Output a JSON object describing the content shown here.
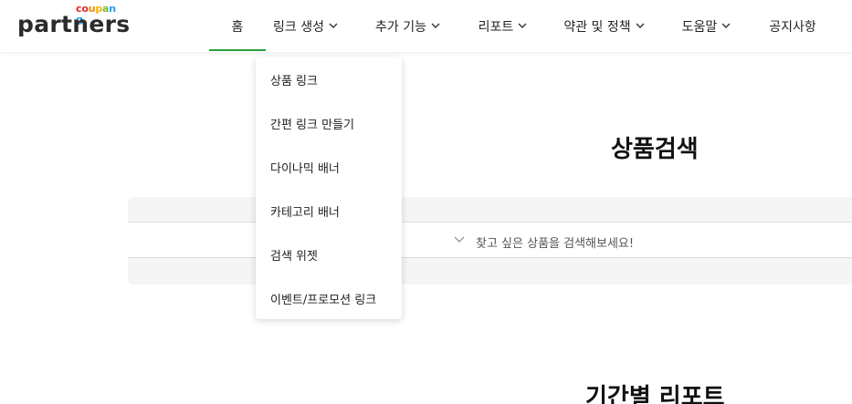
{
  "logo": {
    "small_text": "coupang",
    "small_letters": [
      "c",
      "o",
      "u",
      "p",
      "a",
      "n",
      "g"
    ],
    "small_colors": [
      "#e52528",
      "#e52528",
      "#f28c00",
      "#f5b400",
      "#7fb839",
      "#1da1f2",
      "#1da1f2"
    ],
    "main_text": "partners"
  },
  "nav": {
    "items": [
      {
        "label": "홈",
        "has_chevron": false,
        "active": true
      },
      {
        "label": "링크 생성",
        "has_chevron": true,
        "active": false
      },
      {
        "label": "추가 기능",
        "has_chevron": true,
        "active": false
      },
      {
        "label": "리포트",
        "has_chevron": true,
        "active": false
      },
      {
        "label": "약관 및 정책",
        "has_chevron": true,
        "active": false
      },
      {
        "label": "도움말",
        "has_chevron": true,
        "active": false
      },
      {
        "label": "공지사항",
        "has_chevron": false,
        "active": false
      }
    ],
    "active_color": "#2aa33c"
  },
  "dropdown": {
    "items": [
      {
        "label": "상품 링크"
      },
      {
        "label": "간편 링크 만들기"
      },
      {
        "label": "다이나믹 배너"
      },
      {
        "label": "카테고리 배너"
      },
      {
        "label": "검색 위젯"
      },
      {
        "label": "이벤트/프로모션 링크"
      }
    ]
  },
  "main": {
    "product_search_title": "상품검색",
    "search_placeholder": "찾고 싶은 상품을 검색해보세요!",
    "period_report_title": "기간별 리포트"
  }
}
